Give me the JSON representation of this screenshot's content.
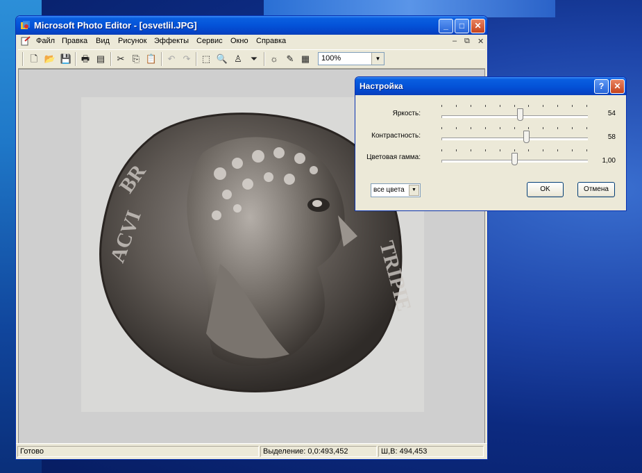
{
  "window": {
    "title": "Microsoft Photo Editor - [osvetlil.JPG]",
    "controls": {
      "minimize": "_",
      "maximize": "□",
      "close": "✕"
    }
  },
  "menu": {
    "items": [
      "Файл",
      "Правка",
      "Вид",
      "Рисунок",
      "Эффекты",
      "Сервис",
      "Окно",
      "Справка"
    ],
    "mdi": {
      "minimize": "–",
      "restore": "⧉",
      "close": "✕"
    }
  },
  "toolbar": {
    "icons": [
      "new-file-icon",
      "open-folder-icon",
      "save-icon",
      "print-icon",
      "scan-icon",
      "cut-icon",
      "copy-icon",
      "paste-icon",
      "undo-icon",
      "redo-icon",
      "select-icon",
      "zoom-icon",
      "stamp-icon",
      "smudge-icon",
      "balance-icon",
      "pen-icon",
      "properties-icon"
    ],
    "zoom": "100%"
  },
  "status": {
    "ready": "Готово",
    "selection": "Выделение: 0,0:493,452",
    "size": "Ш,В: 494,453"
  },
  "dialog": {
    "title": "Настройка",
    "help": "?",
    "close": "✕",
    "sliders": [
      {
        "label": "Яркость:",
        "value": "54",
        "position": 0.54
      },
      {
        "label": "Контрастность:",
        "value": "58",
        "position": 0.58
      },
      {
        "label": "Цветовая гамма:",
        "value": "1,00",
        "position": 0.5
      }
    ],
    "channel": "все цвета",
    "ok": "OK",
    "cancel": "Отмена"
  },
  "colors": {
    "xp_blue": "#0453d8",
    "face": "#ece9d8",
    "close_red": "#c5431c"
  }
}
